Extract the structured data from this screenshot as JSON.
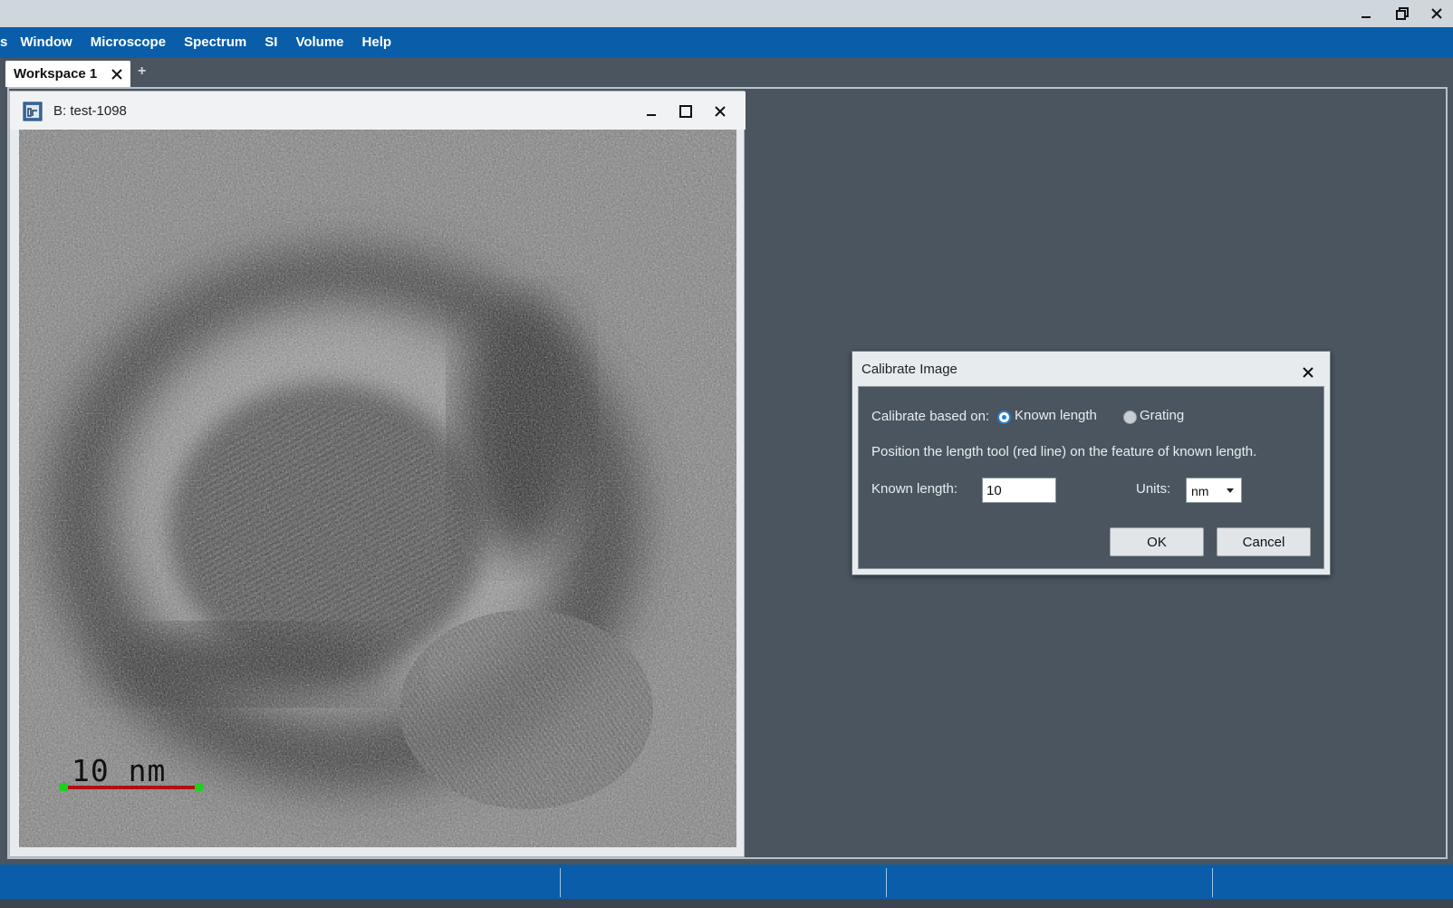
{
  "window": {
    "controls": {
      "minimize_icon": "minimize-icon",
      "restore_icon": "restore-icon",
      "close_icon": "close-icon"
    }
  },
  "menu": {
    "items": [
      "s",
      "Window",
      "Microscope",
      "Spectrum",
      "SI",
      "Volume",
      "Help"
    ]
  },
  "tabs": {
    "active_label": "Workspace 1",
    "add_label": "+"
  },
  "document": {
    "title": "B: test-1098",
    "scale_bar_label": "10 nm"
  },
  "dialog": {
    "title": "Calibrate Image",
    "calibrate_label": "Calibrate based on:",
    "option_known": "Known length",
    "option_grating": "Grating",
    "selected_option": "Known length",
    "instruction": "Position the length tool (red line) on the feature of known length.",
    "known_length_label": "Known length:",
    "known_length_value": "10",
    "units_label": "Units:",
    "units_value": "nm",
    "ok_label": "OK",
    "cancel_label": "Cancel"
  },
  "colors": {
    "menubar": "#0a5ea9",
    "workspace": "#4a555f",
    "scale_line": "#b01010",
    "scale_handle": "#1fcf1f",
    "radio_accent": "#2a7fcf"
  }
}
